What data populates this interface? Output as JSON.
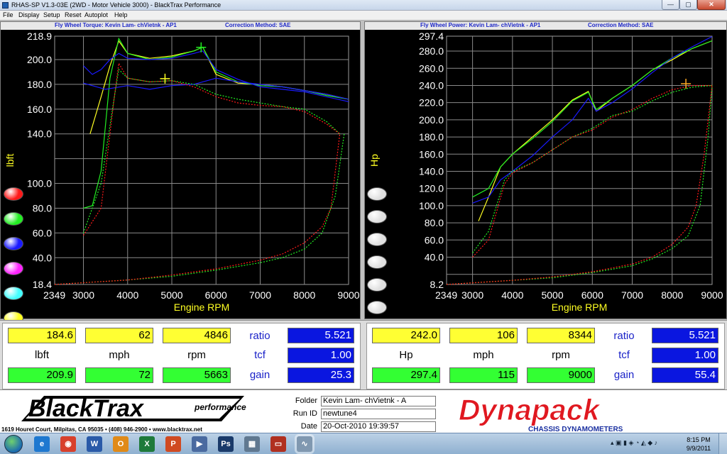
{
  "window": {
    "title": "RHAS-SP V1.3-03E  (2WD - Motor Vehicle 3000) - BlackTrax Performance",
    "min_glyph": "—",
    "max_glyph": "▢",
    "close_glyph": "✕"
  },
  "menu": [
    "File",
    "Display",
    "Setup",
    "Reset",
    "Autoplot",
    "Help"
  ],
  "left_chart": {
    "header_title": "Fly Wheel Torque: Kevin Lam- chVietnk - AP1",
    "header_correction": "Correction Method: SAE",
    "ylabel": "lbft",
    "xlabel": "Engine RPM",
    "y_ticks": [
      "218.9",
      "200.0",
      "180.0",
      "160.0",
      "140.0",
      "100.0",
      "80.0",
      "60.0",
      "40.0",
      "18.4"
    ],
    "y_tick_values": [
      218.9,
      200,
      180,
      160,
      140,
      100,
      80,
      60,
      40,
      18.4
    ],
    "x_ticks": [
      "2349",
      "3000",
      "4000",
      "5000",
      "6000",
      "7000",
      "8000",
      "9000"
    ],
    "x_tick_values": [
      2349,
      3000,
      4000,
      5000,
      6000,
      7000,
      8000,
      9000
    ],
    "y_gridlines": [
      200,
      180,
      160,
      140,
      120,
      100,
      80,
      60,
      40
    ],
    "x_gridlines": [
      3000,
      4000,
      5000,
      6000,
      7000,
      8000
    ],
    "legend_colors": [
      "#ff1a1a",
      "#22ee22",
      "#1a1aff",
      "#ff22ff",
      "#44ffff",
      "#ffff22"
    ]
  },
  "right_chart": {
    "header_title": "Fly Wheel Power: Kevin Lam- chVietnk - AP1",
    "header_correction": "Correction Method: SAE",
    "ylabel": "Hp",
    "xlabel": "Engine RPM",
    "y_ticks": [
      "297.4",
      "280.0",
      "260.0",
      "240.0",
      "220.0",
      "200.0",
      "180.0",
      "160.0",
      "140.0",
      "120.0",
      "100.0",
      "80.0",
      "60.0",
      "40.0",
      "8.2"
    ],
    "y_tick_values": [
      297.4,
      280,
      260,
      240,
      220,
      200,
      180,
      160,
      140,
      120,
      100,
      80,
      60,
      40,
      8.2
    ],
    "x_ticks": [
      "2349",
      "3000",
      "4000",
      "5000",
      "6000",
      "7000",
      "8000",
      "9000"
    ],
    "x_tick_values": [
      2349,
      3000,
      4000,
      5000,
      6000,
      7000,
      8000,
      9000
    ],
    "y_gridlines": [
      280,
      260,
      240,
      220,
      200,
      180,
      160,
      140,
      120,
      100,
      80,
      60,
      40,
      20
    ],
    "x_gridlines": [
      3000,
      4000,
      5000,
      6000,
      7000,
      8000
    ],
    "legend_colors": [
      "#e0e0e0",
      "#e0e0e0",
      "#e0e0e0",
      "#e0e0e0",
      "#e0e0e0",
      "#e0e0e0",
      "#e0e0e0"
    ]
  },
  "chart_data": [
    {
      "type": "line",
      "title": "Fly Wheel Torque: Kevin Lam- chVietnk - AP1",
      "subtitle": "Correction Method: SAE",
      "xlabel": "Engine RPM",
      "ylabel": "lbft",
      "xlim": [
        2349,
        9000
      ],
      "ylim": [
        18.4,
        218.9
      ],
      "grid": true,
      "series": [
        {
          "color": "#ffff22",
          "style": "solid",
          "x": [
            3150,
            3400,
            3600,
            3800,
            4000,
            4500,
            5000,
            5500,
            5700,
            6000,
            6500,
            7000,
            7500,
            8000,
            8500,
            9000
          ],
          "y": [
            140,
            170,
            195,
            215,
            205,
            201,
            203,
            207,
            210,
            188,
            181,
            180,
            178,
            175,
            172,
            168
          ]
        },
        {
          "color": "#22ee22",
          "style": "solid",
          "x": [
            3000,
            3200,
            3400,
            3600,
            3800,
            4000,
            4500,
            5000,
            5500,
            5700,
            6000,
            6500,
            7000,
            7500,
            8000,
            8500,
            9000
          ],
          "y": [
            80,
            82,
            110,
            185,
            217,
            205,
            200,
            202,
            207,
            210,
            190,
            182,
            179,
            178,
            175,
            171,
            168
          ]
        },
        {
          "color": "#1a1aff",
          "style": "solid",
          "x": [
            3000,
            3200,
            3400,
            3600,
            3800,
            4000,
            4500,
            5000,
            5500,
            5700,
            6000,
            6500,
            7000,
            7500,
            8000,
            8500,
            9000
          ],
          "y": [
            195,
            188,
            192,
            200,
            205,
            201,
            200,
            201,
            205,
            207,
            192,
            184,
            178,
            176,
            174,
            170,
            166
          ]
        },
        {
          "color": "#1a1aff",
          "style": "solid",
          "x": [
            3000,
            3500,
            4000,
            4500,
            5000,
            5500,
            6000,
            6500,
            7000,
            7500,
            8000,
            8500,
            9000
          ],
          "y": [
            181,
            176,
            179,
            176,
            179,
            180,
            185,
            182,
            180,
            178,
            175,
            172,
            168
          ]
        },
        {
          "color": "#22ee22",
          "style": "dotted",
          "x": [
            3000,
            3400,
            3700,
            3800,
            4000,
            4500,
            5000,
            5500,
            6000,
            6500,
            7000,
            7500,
            8000,
            8500,
            8800
          ],
          "y": [
            60,
            100,
            170,
            192,
            185,
            182,
            183,
            180,
            172,
            168,
            165,
            162,
            160,
            150,
            140
          ]
        },
        {
          "color": "#ff1a1a",
          "style": "dotted",
          "x": [
            3000,
            3400,
            3700,
            3800,
            4000,
            4500,
            5000,
            5500,
            6000,
            6500,
            7000,
            7500,
            8000,
            8500,
            8800
          ],
          "y": [
            58,
            80,
            170,
            197,
            185,
            182,
            183,
            178,
            170,
            165,
            163,
            162,
            158,
            148,
            140
          ]
        },
        {
          "color": "#22ee22",
          "style": "dotted",
          "x": [
            2349,
            4000,
            5000,
            6000,
            7000,
            7500,
            8000,
            8400,
            8700,
            8900
          ],
          "y": [
            18.4,
            22,
            25,
            30,
            36,
            40,
            47,
            60,
            90,
            140
          ]
        },
        {
          "color": "#ff1a1a",
          "style": "dotted",
          "x": [
            2349,
            4000,
            5000,
            6000,
            7000,
            7500,
            8000,
            8400,
            8600,
            8800
          ],
          "y": [
            18.4,
            22,
            26,
            31,
            38,
            43,
            52,
            65,
            80,
            140
          ]
        }
      ],
      "annotations": [
        {
          "marker": "cross",
          "x": 4846,
          "y": 184.6
        },
        {
          "marker": "cross",
          "x": 5663,
          "y": 209.9
        }
      ]
    },
    {
      "type": "line",
      "title": "Fly Wheel Power: Kevin Lam- chVietnk - AP1",
      "subtitle": "Correction Method: SAE",
      "xlabel": "Engine RPM",
      "ylabel": "Hp",
      "xlim": [
        2349,
        9000
      ],
      "ylim": [
        8.2,
        297.4
      ],
      "grid": true,
      "series": [
        {
          "color": "#ffff22",
          "style": "solid",
          "x": [
            3150,
            3400,
            3700,
            4000,
            4500,
            5000,
            5500,
            5900,
            6100,
            6500,
            7000,
            7500,
            8000,
            8500,
            9000
          ],
          "y": [
            82,
            110,
            145,
            160,
            180,
            200,
            223,
            233,
            210,
            225,
            240,
            258,
            270,
            283,
            292
          ]
        },
        {
          "color": "#22ee22",
          "style": "solid",
          "x": [
            3000,
            3400,
            3700,
            4000,
            4500,
            5000,
            5500,
            5900,
            6100,
            6500,
            7000,
            7500,
            8000,
            8500,
            9000
          ],
          "y": [
            110,
            120,
            145,
            160,
            178,
            198,
            222,
            232,
            212,
            225,
            240,
            258,
            272,
            283,
            292
          ]
        },
        {
          "color": "#1a1aff",
          "style": "solid",
          "x": [
            3000,
            3400,
            3700,
            4000,
            4500,
            5000,
            5500,
            5900,
            6100,
            6500,
            7000,
            7500,
            8000,
            8500,
            9000
          ],
          "y": [
            103,
            110,
            130,
            140,
            158,
            180,
            200,
            225,
            210,
            220,
            236,
            255,
            272,
            285,
            297
          ]
        },
        {
          "color": "#22ee22",
          "style": "dotted",
          "x": [
            3000,
            3400,
            3800,
            4000,
            4500,
            5000,
            5500,
            6000,
            6500,
            7000,
            7500,
            8000,
            8500,
            9000
          ],
          "y": [
            45,
            70,
            130,
            140,
            150,
            165,
            180,
            190,
            205,
            210,
            222,
            232,
            238,
            240
          ]
        },
        {
          "color": "#ff1a1a",
          "style": "dotted",
          "x": [
            3000,
            3400,
            3800,
            4000,
            4500,
            5000,
            5500,
            6000,
            6500,
            7000,
            7500,
            8000,
            8500,
            9000
          ],
          "y": [
            40,
            60,
            125,
            138,
            150,
            165,
            180,
            188,
            203,
            212,
            225,
            235,
            240,
            240
          ]
        },
        {
          "color": "#22ee22",
          "style": "dotted",
          "x": [
            2349,
            4000,
            5000,
            6000,
            7000,
            7500,
            8000,
            8400,
            8700,
            8900,
            9000
          ],
          "y": [
            8.2,
            13,
            16,
            22,
            30,
            38,
            50,
            65,
            100,
            180,
            240
          ]
        },
        {
          "color": "#ff1a1a",
          "style": "dotted",
          "x": [
            2349,
            4000,
            5000,
            6000,
            7000,
            7500,
            8000,
            8400,
            8600,
            8800,
            9000
          ],
          "y": [
            8.2,
            13,
            17,
            23,
            32,
            40,
            55,
            75,
            100,
            160,
            240
          ]
        }
      ],
      "annotations": [
        {
          "marker": "cross",
          "x": 8344,
          "y": 242.0
        }
      ]
    }
  ],
  "left_readout": {
    "row1": [
      "184.6",
      "62",
      "4846"
    ],
    "labels": [
      "lbft",
      "mph",
      "rpm"
    ],
    "row2": [
      "209.9",
      "72",
      "5663"
    ],
    "side_labels": [
      "ratio",
      "tcf",
      "gain"
    ],
    "side_values": [
      "5.521",
      "1.00",
      "25.3"
    ]
  },
  "right_readout": {
    "row1": [
      "242.0",
      "106",
      "8344"
    ],
    "labels": [
      "Hp",
      "mph",
      "rpm"
    ],
    "row2": [
      "297.4",
      "115",
      "9000"
    ],
    "side_labels": [
      "ratio",
      "tcf",
      "gain"
    ],
    "side_values": [
      "5.521",
      "1.00",
      "55.4"
    ]
  },
  "footer": {
    "brand": "BlackTrax",
    "brand_sub": "performance",
    "address": "1619 Houret Court, Milpitas, CA 95035  •  (408) 946-2900  •  www.blacktrax.net",
    "folder_label": "Folder",
    "folder_value": "Kevin Lam- chVietnk - A",
    "runid_label": "Run ID",
    "runid_value": "newtune4",
    "date_label": "Date",
    "date_value": "20-Oct-2010   19:39:57",
    "dyn_brand": "Dynapack",
    "dyn_sub": "CHASSIS          DYNAMOMETERS"
  },
  "taskbar": {
    "icons": [
      {
        "name": "internet-explorer-icon",
        "glyph": "e",
        "color": "#1e78d0"
      },
      {
        "name": "chrome-icon",
        "glyph": "◉",
        "color": "#d8402c"
      },
      {
        "name": "word-icon",
        "glyph": "W",
        "color": "#2a5aa8"
      },
      {
        "name": "outlook-icon",
        "glyph": "O",
        "color": "#e08a18"
      },
      {
        "name": "excel-icon",
        "glyph": "X",
        "color": "#1e7a3a"
      },
      {
        "name": "powerpoint-icon",
        "glyph": "P",
        "color": "#d04a22"
      },
      {
        "name": "media-player-icon",
        "glyph": "▶",
        "color": "#4a6aa0"
      },
      {
        "name": "photoshop-icon",
        "glyph": "Ps",
        "color": "#1a3a6a"
      },
      {
        "name": "paint-icon",
        "glyph": "▦",
        "color": "#607890"
      },
      {
        "name": "acrobat-icon",
        "glyph": "▭",
        "color": "#b03020"
      },
      {
        "name": "dyno-app-icon",
        "glyph": "∿",
        "color": "#8098b0"
      }
    ],
    "time": "8:15 PM",
    "date": "9/9/2011"
  }
}
